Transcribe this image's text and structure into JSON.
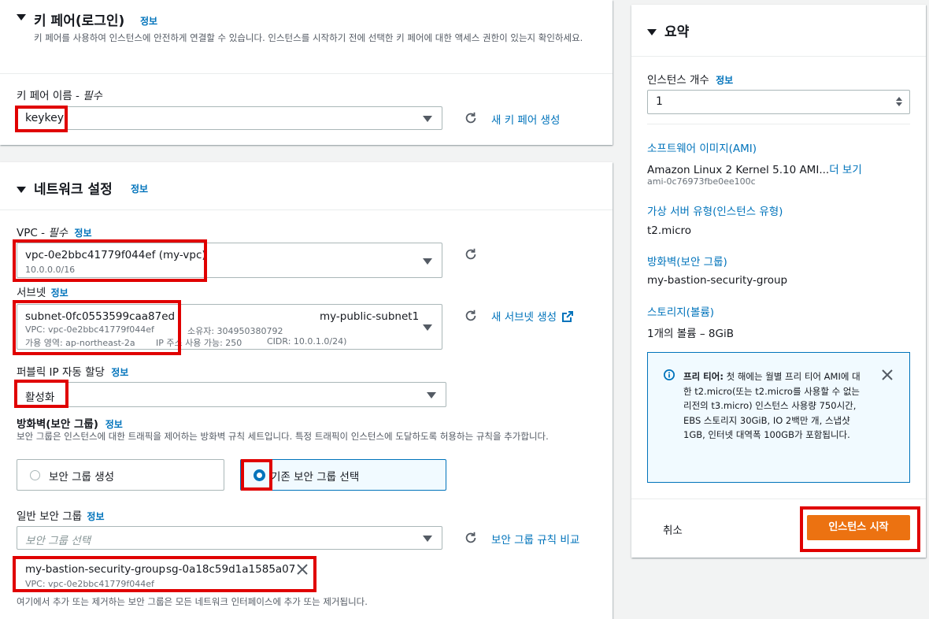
{
  "keypair": {
    "title": "키 페어(로그인)",
    "info": "정보",
    "description": "키 페어를 사용하여 인스턴스에 안전하게 연결할 수 있습니다. 인스턴스를 시작하기 전에 선택한 키 페어에 대한 액세스 권한이 있는지 확인하세요.",
    "name_label": "키 페어 이름 - ",
    "name_required": "필수",
    "name_value": "keykey",
    "create_link": "새 키 페어 생성"
  },
  "network": {
    "title": "네트워크 설정",
    "info": "정보",
    "vpc_label": "VPC - ",
    "vpc_required": "필수",
    "vpc_info": "정보",
    "vpc_value": "vpc-0e2bbc41779f044ef (my-vpc)",
    "vpc_cidr": "10.0.0.0/16",
    "subnet_label": "서브넷",
    "subnet_info": "정보",
    "subnet_value": "subnet-0fc0553599caa87ed",
    "subnet_name": "my-public-subnet1",
    "subnet_vpc": "VPC: vpc-0e2bbc41779f044ef",
    "subnet_owner": "소유자: 304950380792",
    "subnet_az": "가용 영역: ap-northeast-2a",
    "subnet_ip": "IP 주소 사용 가능: 250",
    "subnet_cidr": "CIDR: 10.0.1.0/24)",
    "subnet_create_link": "새 서브넷 생성",
    "public_ip_label": "퍼블릭 IP 자동 할당",
    "public_ip_info": "정보",
    "public_ip_value": "활성화",
    "firewall_label": "방화벽(보안 그룹)",
    "firewall_info": "정보",
    "firewall_desc": "보안 그룹은 인스턴스에 대한 트래픽을 제어하는 방화벽 규칙 세트입니다. 특정 트래픽이 인스턴스에 도달하도록 허용하는 규칙을 추가합니다.",
    "radio_create": "보안 그룹 생성",
    "radio_existing": "기존 보안 그룹 선택",
    "sg_label": "일반 보안 그룹",
    "sg_info": "정보",
    "sg_placeholder": "보안 그룹 선택",
    "sg_compare_link": "보안 그룹 규칙 비교",
    "sg_token_name": "my-bastion-security-group",
    "sg_token_id": "sg-0a18c59d1a1585a07",
    "sg_token_vpc": "VPC: vpc-0e2bbc41779f044ef",
    "sg_footer": "여기에서 추가 또는 제거하는 보안 그룹은 모든 네트워크 인터페이스에 추가 또는 제거됩니다."
  },
  "summary": {
    "title": "요약",
    "instance_count_label": "인스턴스 개수",
    "instance_count_info": "정보",
    "instance_count_value": "1",
    "ami_label": "소프트웨어 이미지(AMI)",
    "ami_value": "Amazon Linux 2 Kernel 5.10 AMI...",
    "ami_more": "더 보기",
    "ami_id": "ami-0c76973fbe0ee100c",
    "type_label": "가상 서버 유형(인스턴스 유형)",
    "type_value": "t2.micro",
    "sg_label": "방화벽(보안 그룹)",
    "sg_value": "my-bastion-security-group",
    "storage_label": "스토리지(볼륨)",
    "storage_value": "1개의 볼륨 – 8GiB",
    "free_tier_bold": "프리 티어:",
    "free_tier_text": " 첫 해에는 월별 프리 티어 AMI에 대한 t2.micro(또는 t2.micro를 사용할 수 없는 리전의 t3.micro) 인스턴스 사용량 750시간, EBS 스토리지 30GiB, IO 2백만 개, 스냅샷 1GB, 인터넷 대역폭 100GB가 포함됩니다.",
    "cancel": "취소",
    "launch": "인스턴스 시작"
  },
  "colors": {
    "accent": "#ec7211",
    "link": "#0073bb",
    "highlight": "#e00000"
  }
}
